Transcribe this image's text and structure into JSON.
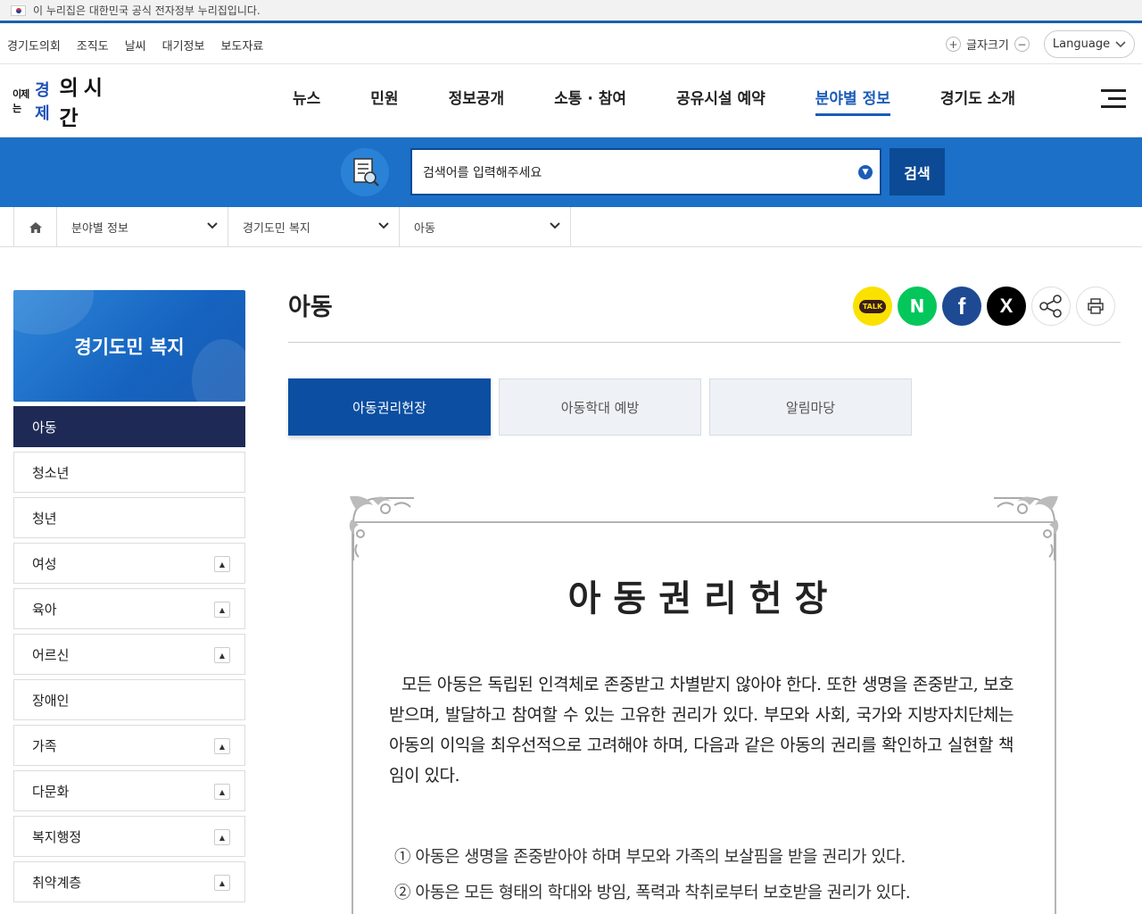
{
  "gov_banner": {
    "text": "이 누리집은 대한민국 공식 전자정부 누리집입니다."
  },
  "util_links": [
    "경기도의회",
    "조직도",
    "날씨",
    "대기정보",
    "보도자료"
  ],
  "font_size": {
    "label": "글자크기",
    "plus": "+",
    "minus": "−"
  },
  "language": {
    "label": "Language"
  },
  "logo": {
    "part1": "이제는",
    "part2": "경제",
    "part3": "의 시간"
  },
  "gnb": [
    "뉴스",
    "민원",
    "정보공개",
    "소통 · 참여",
    "공유시설 예약",
    "분야별 정보",
    "경기도 소개"
  ],
  "gnb_active": "분야별 정보",
  "search": {
    "placeholder": "검색어를 입력해주세요",
    "button": "검색"
  },
  "breadcrumb": [
    "분야별 정보",
    "경기도민 복지",
    "아동"
  ],
  "sidebar": {
    "title": "경기도민 복지",
    "items": [
      {
        "label": "아동",
        "active": true,
        "toggle": false
      },
      {
        "label": "청소년",
        "toggle": false
      },
      {
        "label": "청년",
        "toggle": false
      },
      {
        "label": "여성",
        "toggle": true
      },
      {
        "label": "육아",
        "toggle": true
      },
      {
        "label": "어르신",
        "toggle": true
      },
      {
        "label": "장애인",
        "toggle": false
      },
      {
        "label": "가족",
        "toggle": true
      },
      {
        "label": "다문화",
        "toggle": true
      },
      {
        "label": "복지행정",
        "toggle": true
      },
      {
        "label": "취약계층",
        "toggle": true
      }
    ]
  },
  "page": {
    "title": "아동"
  },
  "share": {
    "kakao": "TALK",
    "naver": "N",
    "facebook": "f",
    "x": "X"
  },
  "tabs": [
    {
      "label": "아동권리헌장",
      "active": true
    },
    {
      "label": "아동학대 예방"
    },
    {
      "label": "알림마당"
    }
  ],
  "charter": {
    "title": "아동권리헌장",
    "intro": "모든 아동은 독립된 인격체로 존중받고 차별받지 않아야 한다. 또한 생명을 존중받고, 보호받으며, 발달하고 참여할 수 있는 고유한 권리가 있다. 부모와 사회, 국가와 지방자치단체는 아동의 이익을 최우선적으로 고려해야 하며, 다음과 같은 아동의 권리를 확인하고 실현할 책임이 있다.",
    "items": [
      "① 아동은 생명을 존중받아야 하며 부모와 가족의 보살핌을 받을 권리가 있다.",
      "② 아동은 모든 형태의 학대와 방임, 폭력과 착취로부터 보호받을 권리가 있다."
    ]
  }
}
